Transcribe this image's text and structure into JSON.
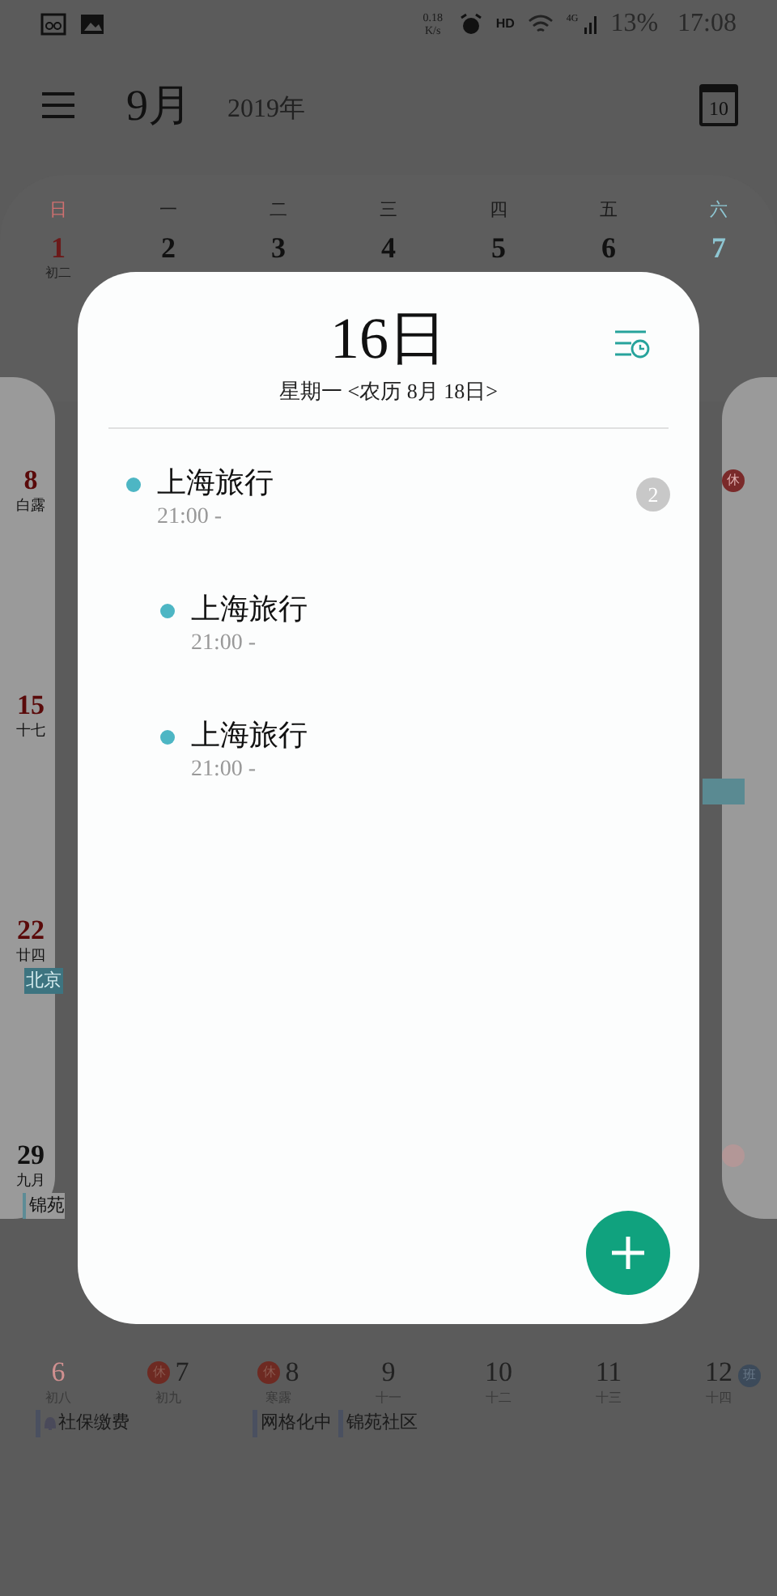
{
  "status_bar": {
    "net_speed": "0.18 K/s",
    "hd": "HD",
    "network": "4G",
    "battery": "13%",
    "time": "17:08"
  },
  "header": {
    "month": "9月",
    "year": "2019年",
    "today_button": "10"
  },
  "calendar": {
    "weekdays": [
      "日",
      "一",
      "二",
      "三",
      "四",
      "五",
      "六"
    ],
    "first_week": [
      {
        "date": "1",
        "lunar": "初二"
      },
      {
        "date": "2"
      },
      {
        "date": "3"
      },
      {
        "date": "4"
      },
      {
        "date": "5"
      },
      {
        "date": "6"
      },
      {
        "date": "7"
      }
    ],
    "left_column": [
      {
        "date": "8",
        "lunar": "白露"
      },
      {
        "date": "15",
        "lunar": "十七"
      },
      {
        "date": "22",
        "lunar": "廿四",
        "event": "北京"
      },
      {
        "date": "29",
        "lunar": "九月",
        "event": "锦苑"
      }
    ],
    "right_column": [
      {
        "kind": "badge",
        "badge": "休",
        "color": "#7a2a2a"
      },
      {
        "kind": "event_bar"
      },
      {
        "kind": "dot"
      }
    ],
    "last_week": [
      {
        "date": "6",
        "lunar": "初八"
      },
      {
        "date": "7",
        "lunar": "初九",
        "badge": "休",
        "color": "#6e2a22"
      },
      {
        "date": "8",
        "lunar": "寒露",
        "badge": "休",
        "color": "#6e2a22"
      },
      {
        "date": "9",
        "lunar": "十一"
      },
      {
        "date": "10",
        "lunar": "十二"
      },
      {
        "date": "11",
        "lunar": "十三"
      },
      {
        "date": "12",
        "lunar": "十四"
      }
    ],
    "overflow_badge": {
      "badge": "班",
      "color": "#3c4a5a"
    },
    "last_week_events": [
      "社保缴费",
      "网格化中",
      "锦苑社区"
    ]
  },
  "popup": {
    "title": "16日",
    "subtitle": "星期一 <农历 8月 18日>",
    "events": [
      {
        "title": "上海旅行",
        "time": "21:00 -",
        "color": "#4db6c4",
        "count": "2",
        "children": [
          {
            "title": "上海旅行",
            "time": "21:00 -",
            "color": "#4db6c4"
          },
          {
            "title": "上海旅行",
            "time": "21:00 -",
            "color": "#4db6c4"
          }
        ]
      }
    ]
  }
}
